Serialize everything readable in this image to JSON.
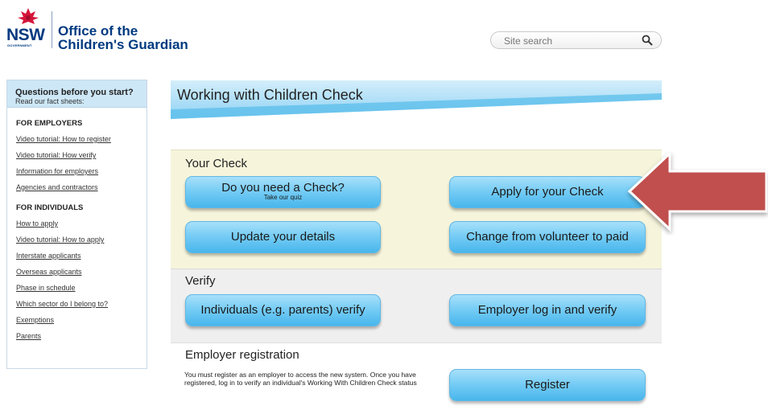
{
  "header": {
    "logo_text": "NSW",
    "logo_subtext": "GOVERNMENT",
    "org_name_line1": "Office of the",
    "org_name_line2": "Children's Guardian"
  },
  "search": {
    "placeholder": "Site search",
    "icon": "search-icon"
  },
  "sidebar": {
    "question": "Questions before you start?",
    "subtitle": "Read our fact sheets:",
    "sections": [
      {
        "title": "FOR EMPLOYERS",
        "links": [
          "Video tutorial: How to register",
          "Video tutorial: How verify",
          "Information for employers",
          "Agencies and contractors"
        ]
      },
      {
        "title": "FOR INDIVIDUALS",
        "links": [
          "How to apply",
          "Video tutorial: How to apply",
          "Interstate applicants",
          "Overseas applicants",
          "Phase in schedule",
          "Which sector do I belong to?",
          "Exemptions",
          "Parents"
        ]
      }
    ]
  },
  "main": {
    "title": "Working with Children Check",
    "your_check": {
      "heading": "Your Check",
      "buttons": {
        "need_check": "Do you need a Check?",
        "need_check_sub": "Take our quiz",
        "apply": "Apply for your Check",
        "update": "Update your details",
        "change": "Change from volunteer to paid"
      }
    },
    "verify": {
      "heading": "Verify",
      "buttons": {
        "individuals": "Individuals (e.g. parents) verify",
        "employer": "Employer log in and verify"
      }
    },
    "employer_registration": {
      "heading": "Employer registration",
      "text": "You must register as an employer to access the new system. Once you have registered, log in to verify an individual's Working With Children Check status",
      "button": "Register"
    }
  },
  "colors": {
    "brand_blue": "#003a80",
    "button_blue": "#77cdf5",
    "arrow_red": "#c0504d",
    "panel_yellow": "#f6f5dc"
  }
}
